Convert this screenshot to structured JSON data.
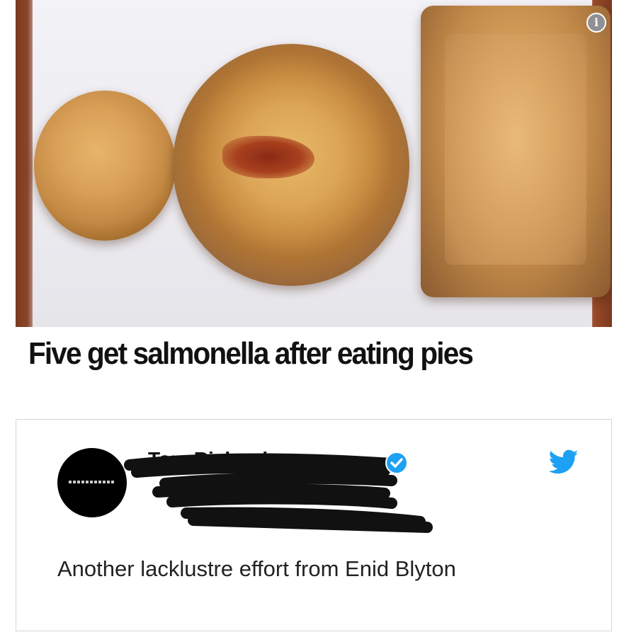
{
  "article": {
    "headline": "Five get salmonella after eating pies",
    "info_icon": "info-icon"
  },
  "tweet": {
    "display_name": "Tom Richardson",
    "verified_icon": "verified-badge-icon",
    "platform_icon": "twitter-bird-icon",
    "text": "Another lacklustre effort from Enid Blyton",
    "colors": {
      "verified": "#1da1f2",
      "bird": "#1da1f2",
      "scribble": "#111111"
    }
  }
}
